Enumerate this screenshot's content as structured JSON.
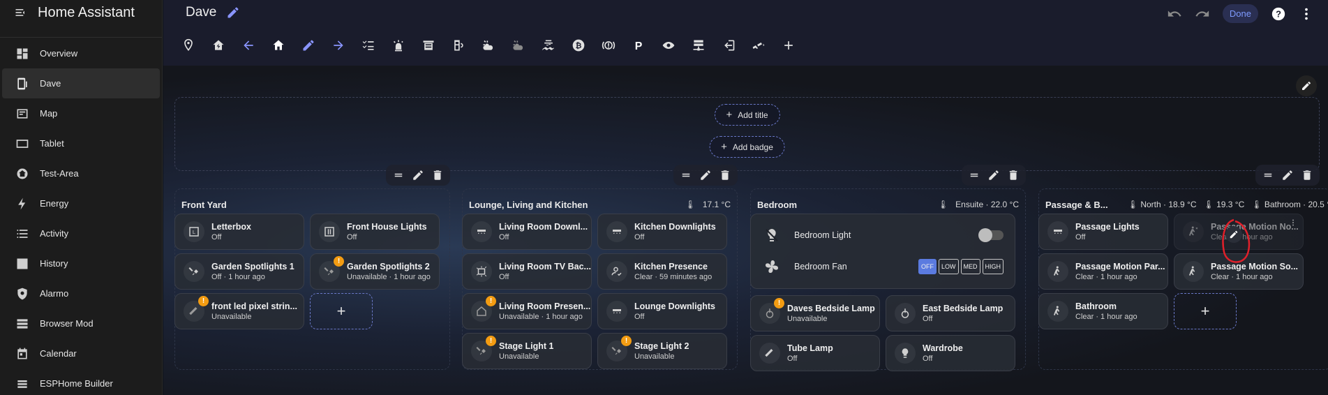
{
  "sidebar": {
    "title": "Home Assistant",
    "items": [
      {
        "label": "Overview",
        "icon": "dashboard-icon",
        "active": false
      },
      {
        "label": "Dave",
        "icon": "tablet-icon",
        "active": true
      },
      {
        "label": "Map",
        "icon": "map-icon",
        "active": false
      },
      {
        "label": "Tablet",
        "icon": "tablet-icon",
        "active": false
      },
      {
        "label": "Test-Area",
        "icon": "home-icon",
        "active": false
      },
      {
        "label": "Energy",
        "icon": "lightning-icon",
        "active": false
      },
      {
        "label": "Activity",
        "icon": "list-icon",
        "active": false
      },
      {
        "label": "History",
        "icon": "chart-icon",
        "active": false
      },
      {
        "label": "Alarmo",
        "icon": "shield-icon",
        "active": false
      },
      {
        "label": "Browser Mod",
        "icon": "server-icon",
        "active": false
      },
      {
        "label": "Calendar",
        "icon": "calendar-icon",
        "active": false
      },
      {
        "label": "ESPHome Builder",
        "icon": "esphome-icon",
        "active": false
      }
    ]
  },
  "topbar": {
    "title": "Dave",
    "done_label": "Done"
  },
  "header_area": {
    "add_title": "Add title",
    "add_badge": "Add badge"
  },
  "sections": {
    "front_yard": {
      "title": "Front Yard",
      "cards": [
        {
          "name": "Letterbox",
          "state": "Off"
        },
        {
          "name": "Front House Lights",
          "state": "Off"
        },
        {
          "name": "Garden Spotlights 1",
          "state": "Off · 1 hour ago"
        },
        {
          "name": "Garden Spotlights 2",
          "state": "Unavailable · 1 hour ago"
        },
        {
          "name": "front led pixel strin...",
          "state": "Unavailable"
        }
      ]
    },
    "lounge": {
      "title": "Lounge, Living and Kitchen",
      "temp": "17.1 °C",
      "cards": [
        {
          "name": "Living Room Downl...",
          "state": "Off"
        },
        {
          "name": "Kitchen Downlights",
          "state": "Off"
        },
        {
          "name": "Living Room TV Bac...",
          "state": "Off"
        },
        {
          "name": "Kitchen Presence",
          "state": "Clear · 59 minutes ago"
        },
        {
          "name": "Living Room Presen...",
          "state": "Unavailable · 1 hour ago"
        },
        {
          "name": "Lounge Downlights",
          "state": "Off"
        },
        {
          "name": "Stage Light 1",
          "state": "Unavailable"
        },
        {
          "name": "Stage Light 2",
          "state": "Unavailable"
        }
      ]
    },
    "bedroom": {
      "title": "Bedroom",
      "temp": "Ensuite · 22.0 °C",
      "entities": [
        {
          "name": "Bedroom Light"
        },
        {
          "name": "Bedroom Fan"
        }
      ],
      "fan_modes": [
        "OFF",
        "LOW",
        "MED",
        "HIGH"
      ],
      "cards": [
        {
          "name": "Daves Bedside Lamp",
          "state": "Unavailable"
        },
        {
          "name": "East Bedside Lamp",
          "state": "Off"
        },
        {
          "name": "Tube Lamp",
          "state": "Off"
        },
        {
          "name": "Wardrobe",
          "state": "Off"
        }
      ]
    },
    "passage": {
      "title": "Passage & B...",
      "temps": [
        "North · 18.9 °C",
        "19.3 °C",
        "Bathroom · 20.5 °"
      ],
      "cards": [
        {
          "name": "Passage Lights",
          "state": "Off"
        },
        {
          "name": "Passage Motion No...",
          "state": "Clear · 1 hour ago"
        },
        {
          "name": "Passage Motion Par...",
          "state": "Clear · 1 hour ago"
        },
        {
          "name": "Passage Motion So...",
          "state": "Clear · 1 hour ago"
        },
        {
          "name": "Bathroom",
          "state": "Clear · 1 hour ago"
        }
      ]
    }
  },
  "colors": {
    "accent": "#7f9bff",
    "warning": "#f39c12",
    "annotation": "#e0202a"
  }
}
